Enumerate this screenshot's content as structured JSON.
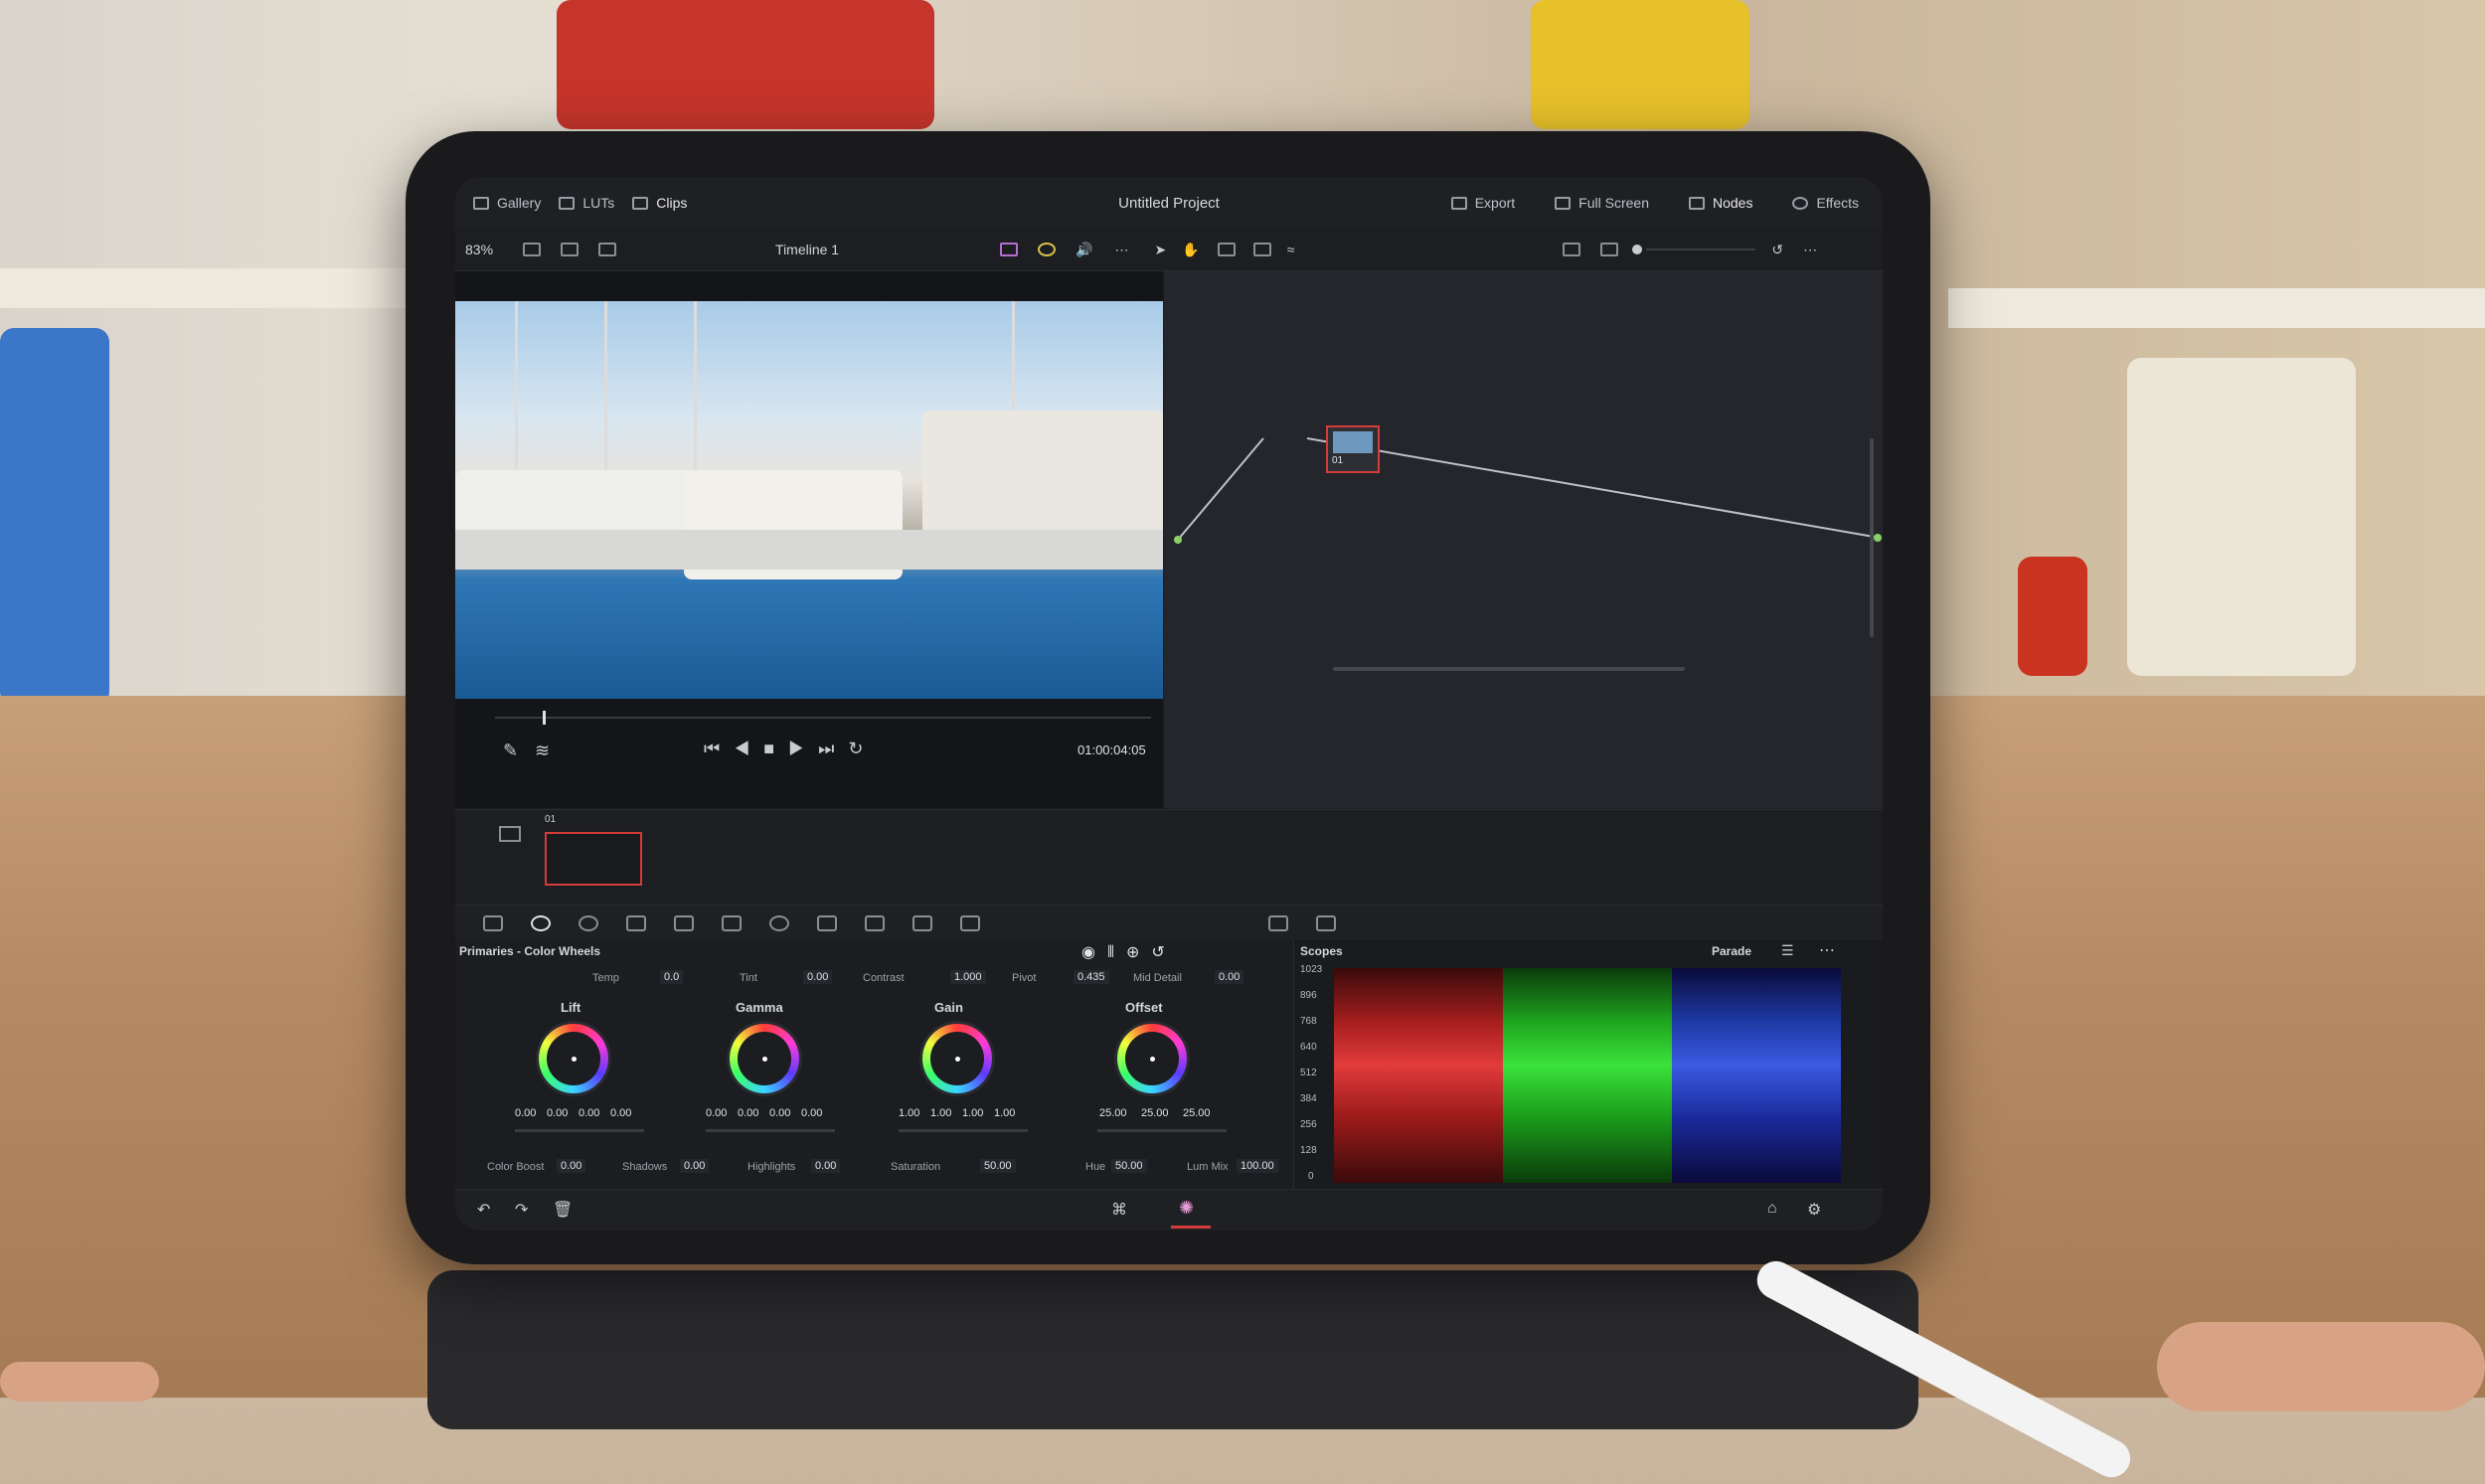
{
  "topbar": {
    "gallery": "Gallery",
    "luts": "LUTs",
    "clips": "Clips",
    "title": "Untitled Project",
    "export": "Export",
    "full_screen": "Full Screen",
    "nodes": "Nodes",
    "effects": "Effects"
  },
  "viewer": {
    "zoom": "83%",
    "timeline": "Timeline 1",
    "timecode": "01:00:04:05"
  },
  "node_editor": {
    "node_label": "01"
  },
  "clips": {
    "clip_label": "01"
  },
  "primaries": {
    "title": "Primaries - Color Wheels",
    "temp_label": "Temp",
    "temp": "0.0",
    "tint_label": "Tint",
    "tint": "0.00",
    "contrast_label": "Contrast",
    "contrast": "1.000",
    "pivot_label": "Pivot",
    "pivot": "0.435",
    "middetail_label": "Mid Detail",
    "middetail": "0.00",
    "wheels": [
      {
        "name": "Lift",
        "values": [
          "0.00",
          "0.00",
          "0.00",
          "0.00"
        ]
      },
      {
        "name": "Gamma",
        "values": [
          "0.00",
          "0.00",
          "0.00",
          "0.00"
        ]
      },
      {
        "name": "Gain",
        "values": [
          "1.00",
          "1.00",
          "1.00",
          "1.00"
        ]
      },
      {
        "name": "Offset",
        "values": [
          "25.00",
          "25.00",
          "25.00"
        ]
      }
    ],
    "colorboost_label": "Color Boost",
    "colorboost": "0.00",
    "shadows_label": "Shadows",
    "shadows": "0.00",
    "highlights_label": "Highlights",
    "highlights": "0.00",
    "saturation_label": "Saturation",
    "saturation": "50.00",
    "hue_label": "Hue",
    "hue": "50.00",
    "lummix_label": "Lum Mix",
    "lummix": "100.00"
  },
  "scopes": {
    "title": "Scopes",
    "mode": "Parade",
    "ticks": [
      "1023",
      "896",
      "768",
      "640",
      "512",
      "384",
      "256",
      "128",
      "0"
    ]
  },
  "colors": {
    "accent_red": "#d43b3b",
    "panel_bg": "#1c1d21"
  }
}
